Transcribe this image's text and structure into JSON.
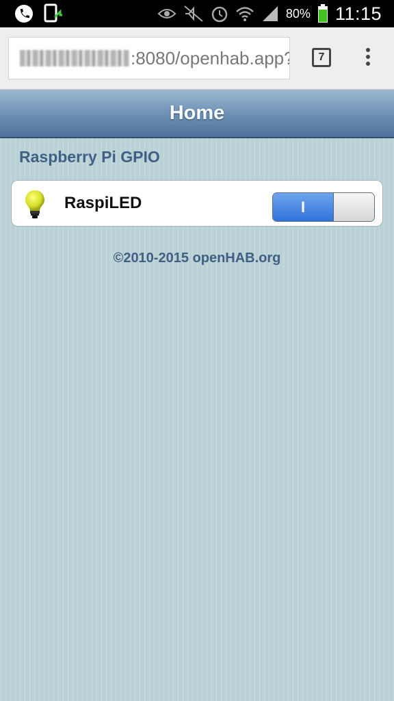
{
  "status_bar": {
    "icons_left": [
      "phone-call-icon",
      "screen-rotate-icon"
    ],
    "icons_right": [
      "eye-icon",
      "mute-icon",
      "alarm-icon",
      "wifi-icon",
      "signal-icon",
      "battery-icon"
    ],
    "battery_percent": "80%",
    "time": "11:15"
  },
  "browser": {
    "url_host_obscured": true,
    "url_visible": ":8080/openhab.app?",
    "tab_count": "7"
  },
  "header": {
    "title": "Home"
  },
  "section": {
    "title": "Raspberry Pi GPIO",
    "items": [
      {
        "label": "RaspiLED",
        "icon": "lightbulb-icon",
        "state_label": "I",
        "on": true
      }
    ]
  },
  "footer": {
    "text": "©2010-2015 openHAB.org"
  },
  "colors": {
    "accent": "#2f73d9",
    "header": "#6b8fb3",
    "section_title": "#3f5f85",
    "background": "#b9d1d5"
  }
}
